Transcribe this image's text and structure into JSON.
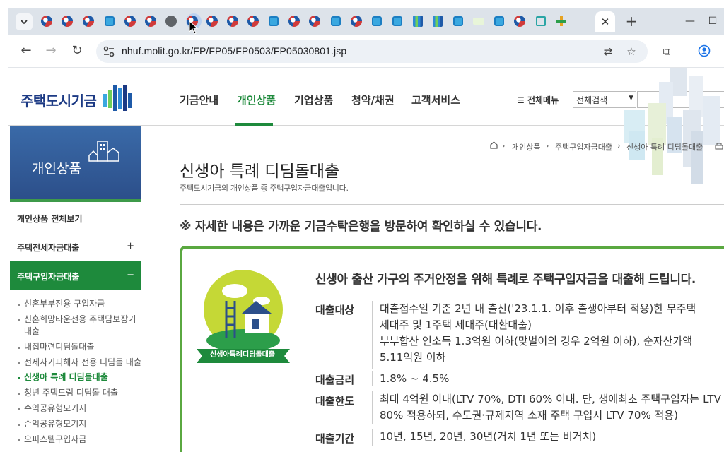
{
  "browser": {
    "url": "nhuf.molit.go.kr/FP/FP05/FP0503/FP05030801.jsp",
    "tab_favicons": [
      "gov-icon",
      "gov-icon",
      "gov-icon",
      "nhuf-icon",
      "gov-icon",
      "gov-icon",
      "globe-icon",
      "gov-icon-active",
      "gov-icon",
      "gov-icon",
      "gov-icon",
      "nhuf-icon",
      "gov-icon",
      "gov-icon",
      "nhuf-icon",
      "gov-icon",
      "nhuf-icon",
      "nhuf-icon",
      "bars-icon",
      "bars-icon",
      "nhuf-icon",
      "lh-icon",
      "nhuf-icon",
      "gov-icon",
      "house-icon",
      "plus-icon"
    ],
    "active_tab_close": "✕",
    "new_tab": "+"
  },
  "header": {
    "logo": "주택도시기금",
    "menu": [
      "기금안내",
      "개인상품",
      "기업상품",
      "청약/채권",
      "고객서비스"
    ],
    "active_menu": "개인상품",
    "all_menu": "전체메뉴",
    "search_select": "전체검색"
  },
  "sidebar": {
    "title": "개인상품",
    "sections": [
      {
        "label": "개인상품 전체보기",
        "toggle": ""
      },
      {
        "label": "주택전세자금대출",
        "toggle": "+"
      },
      {
        "label": "주택구입자금대출",
        "toggle": "−"
      }
    ],
    "items": [
      "신혼부부전용 구입자금",
      "신혼희망타운전용 주택담보장기대출",
      "내집마련디딤돌대출",
      "전세사기피해자 전용 디딤돌 대출",
      "신생아 특례 디딤돌대출",
      "청년 주택드림 디딤돌 대출",
      "수익공유형모기지",
      "손익공유형모기지",
      "오피스텔구입자금"
    ]
  },
  "breadcrumb": [
    "개인상품",
    "주택구입자금대출",
    "신생아 특례 디딤돌대출"
  ],
  "page": {
    "title": "신생아 특례 디딤돌대출",
    "desc": "주택도시기금의 개인상품 중 주택구입자금대출입니다.",
    "notice": "※ 자세한 내용은 가까운 기금수탁은행을 방문하여 확인하실 수 있습니다."
  },
  "card": {
    "emblem_caption": "신생아특례디딤돌대출",
    "headline": "신생아 출산 가구의 주거안정을 위해 특례로 주택구입자금을 대출해 드립니다.",
    "rows": [
      {
        "term": "대출대상",
        "lines": [
          "대출접수일 기준 2년 내 출산('23.1.1. 이후 출생아부터 적용)한 무주택",
          "세대주 및 1주택 세대주(대환대출)",
          "부부합산 연소득 1.3억원 이하(맞벌이의 경우 2억원 이하), 순자산가액",
          "5.11억원 이하"
        ]
      },
      {
        "term": "대출금리",
        "lines": [
          "1.8% ~ 4.5%"
        ]
      },
      {
        "term": "대출한도",
        "lines": [
          "최대 4억원 이내(LTV 70%, DTI 60% 이내. 단, 생애최초 주택구입자는 LTV",
          "80% 적용하되, 수도권·규제지역 소재 주택 구입시 LTV 70% 적용)"
        ]
      },
      {
        "term": "대출기간",
        "lines": [
          "10년, 15년, 20년, 30년(거치 1년 또는 비거치)"
        ]
      }
    ]
  }
}
